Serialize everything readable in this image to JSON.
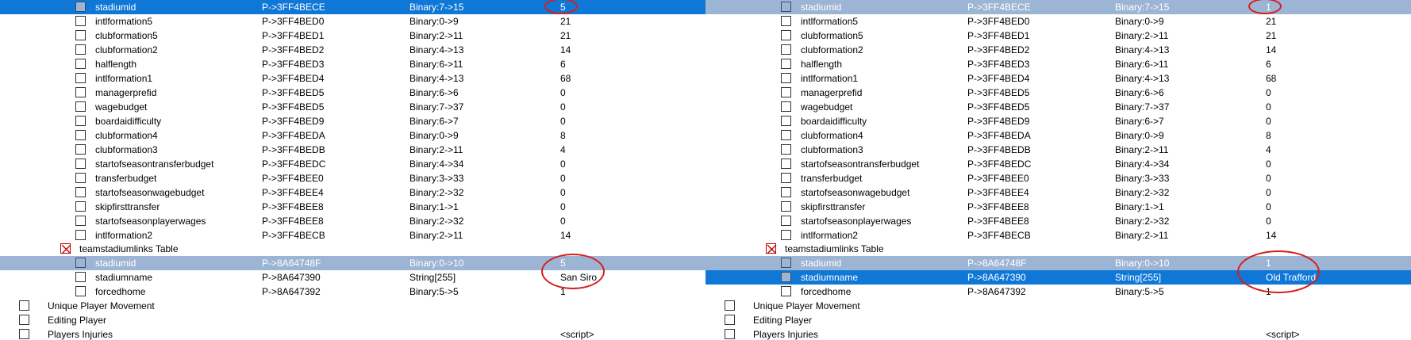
{
  "panels": [
    {
      "rows": [
        {
          "name": "stadiumid",
          "addr": "P->3FF4BECE",
          "type": "Binary:7->15",
          "value": "5"
        },
        {
          "name": "intlformation5",
          "addr": "P->3FF4BED0",
          "type": "Binary:0->9",
          "value": "21"
        },
        {
          "name": "clubformation5",
          "addr": "P->3FF4BED1",
          "type": "Binary:2->11",
          "value": "21"
        },
        {
          "name": "clubformation2",
          "addr": "P->3FF4BED2",
          "type": "Binary:4->13",
          "value": "14"
        },
        {
          "name": "halflength",
          "addr": "P->3FF4BED3",
          "type": "Binary:6->11",
          "value": "6"
        },
        {
          "name": "intlformation1",
          "addr": "P->3FF4BED4",
          "type": "Binary:4->13",
          "value": "68"
        },
        {
          "name": "managerprefid",
          "addr": "P->3FF4BED5",
          "type": "Binary:6->6",
          "value": "0"
        },
        {
          "name": "wagebudget",
          "addr": "P->3FF4BED5",
          "type": "Binary:7->37",
          "value": "0"
        },
        {
          "name": "boardaidifficulty",
          "addr": "P->3FF4BED9",
          "type": "Binary:6->7",
          "value": "0"
        },
        {
          "name": "clubformation4",
          "addr": "P->3FF4BEDA",
          "type": "Binary:0->9",
          "value": "8"
        },
        {
          "name": "clubformation3",
          "addr": "P->3FF4BEDB",
          "type": "Binary:2->11",
          "value": "4"
        },
        {
          "name": "startofseasontransferbudget",
          "addr": "P->3FF4BEDC",
          "type": "Binary:4->34",
          "value": "0"
        },
        {
          "name": "transferbudget",
          "addr": "P->3FF4BEE0",
          "type": "Binary:3->33",
          "value": "0"
        },
        {
          "name": "startofseasonwagebudget",
          "addr": "P->3FF4BEE4",
          "type": "Binary:2->32",
          "value": "0"
        },
        {
          "name": "skipfirsttransfer",
          "addr": "P->3FF4BEE8",
          "type": "Binary:1->1",
          "value": "0"
        },
        {
          "name": "startofseasonplayerwages",
          "addr": "P->3FF4BEE8",
          "type": "Binary:2->32",
          "value": "0"
        },
        {
          "name": "intlformation2",
          "addr": "P->3FF4BECB",
          "type": "Binary:2->11",
          "value": "14"
        }
      ],
      "table_label": "teamstadiumlinks Table",
      "link_rows": [
        {
          "name": "stadiumid",
          "addr": "P->8A64748F",
          "type": "Binary:0->10",
          "value": "5"
        },
        {
          "name": "stadiumname",
          "addr": "P->8A647390",
          "type": "String[255]",
          "value": "San Siro"
        },
        {
          "name": "forcedhome",
          "addr": "P->8A647392",
          "type": "Binary:5->5",
          "value": "1"
        }
      ],
      "footer_rows": [
        {
          "label": "Unique Player Movement",
          "value": ""
        },
        {
          "label": "Editing Player",
          "value": ""
        },
        {
          "label": "Players Injuries",
          "value": "<script>"
        }
      ]
    },
    {
      "rows": [
        {
          "name": "stadiumid",
          "addr": "P->3FF4BECE",
          "type": "Binary:7->15",
          "value": "1"
        },
        {
          "name": "intlformation5",
          "addr": "P->3FF4BED0",
          "type": "Binary:0->9",
          "value": "21"
        },
        {
          "name": "clubformation5",
          "addr": "P->3FF4BED1",
          "type": "Binary:2->11",
          "value": "21"
        },
        {
          "name": "clubformation2",
          "addr": "P->3FF4BED2",
          "type": "Binary:4->13",
          "value": "14"
        },
        {
          "name": "halflength",
          "addr": "P->3FF4BED3",
          "type": "Binary:6->11",
          "value": "6"
        },
        {
          "name": "intlformation1",
          "addr": "P->3FF4BED4",
          "type": "Binary:4->13",
          "value": "68"
        },
        {
          "name": "managerprefid",
          "addr": "P->3FF4BED5",
          "type": "Binary:6->6",
          "value": "0"
        },
        {
          "name": "wagebudget",
          "addr": "P->3FF4BED5",
          "type": "Binary:7->37",
          "value": "0"
        },
        {
          "name": "boardaidifficulty",
          "addr": "P->3FF4BED9",
          "type": "Binary:6->7",
          "value": "0"
        },
        {
          "name": "clubformation4",
          "addr": "P->3FF4BEDA",
          "type": "Binary:0->9",
          "value": "8"
        },
        {
          "name": "clubformation3",
          "addr": "P->3FF4BEDB",
          "type": "Binary:2->11",
          "value": "4"
        },
        {
          "name": "startofseasontransferbudget",
          "addr": "P->3FF4BEDC",
          "type": "Binary:4->34",
          "value": "0"
        },
        {
          "name": "transferbudget",
          "addr": "P->3FF4BEE0",
          "type": "Binary:3->33",
          "value": "0"
        },
        {
          "name": "startofseasonwagebudget",
          "addr": "P->3FF4BEE4",
          "type": "Binary:2->32",
          "value": "0"
        },
        {
          "name": "skipfirsttransfer",
          "addr": "P->3FF4BEE8",
          "type": "Binary:1->1",
          "value": "0"
        },
        {
          "name": "startofseasonplayerwages",
          "addr": "P->3FF4BEE8",
          "type": "Binary:2->32",
          "value": "0"
        },
        {
          "name": "intlformation2",
          "addr": "P->3FF4BECB",
          "type": "Binary:2->11",
          "value": "14"
        }
      ],
      "table_label": "teamstadiumlinks Table",
      "link_rows": [
        {
          "name": "stadiumid",
          "addr": "P->8A64748F",
          "type": "Binary:0->10",
          "value": "1"
        },
        {
          "name": "stadiumname",
          "addr": "P->8A647390",
          "type": "String[255]",
          "value": "Old Trafford"
        },
        {
          "name": "forcedhome",
          "addr": "P->8A647392",
          "type": "Binary:5->5",
          "value": "1"
        }
      ],
      "footer_rows": [
        {
          "label": "Unique Player Movement",
          "value": ""
        },
        {
          "label": "Editing Player",
          "value": ""
        },
        {
          "label": "Players Injuries",
          "value": "<script>"
        }
      ]
    }
  ],
  "colors": {
    "selected_blue": "#0f78d7",
    "selected_gray": "#9db5d4",
    "highlight_circle": "#d81e1e"
  }
}
